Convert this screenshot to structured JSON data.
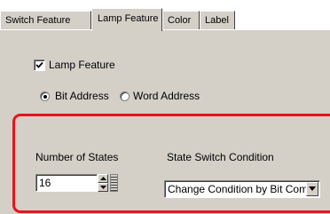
{
  "tabs": [
    {
      "label": "Switch Feature",
      "active": false
    },
    {
      "label": "Lamp Feature",
      "active": true
    },
    {
      "label": "Color",
      "active": false
    },
    {
      "label": "Label",
      "active": false
    }
  ],
  "lamp_feature": {
    "label": "Lamp Feature",
    "checked": true
  },
  "address_type": {
    "options": [
      {
        "label": "Bit Address",
        "selected": true
      },
      {
        "label": "Word Address",
        "selected": false
      }
    ]
  },
  "number_of_states": {
    "label": "Number of States",
    "value": "16"
  },
  "state_switch_condition": {
    "label": "State Switch Condition",
    "value": "Change Condition by Bit Combination"
  },
  "colors": {
    "highlight": "#e8141c",
    "face": "#d4d0c8"
  }
}
